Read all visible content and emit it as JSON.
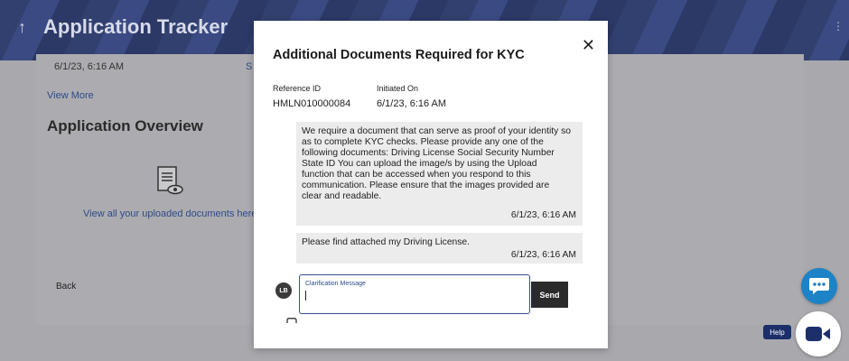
{
  "background": {
    "header_title": "Application Tracker",
    "date_text": "6/1/23, 6:16 AM",
    "status_fragment": "S",
    "view_more": "View More",
    "section_title": "Application Overview",
    "view_all_docs": "View all your uploaded documents here",
    "back_label": "Back"
  },
  "modal": {
    "title": "Additional Documents Required for KYC",
    "reference_label": "Reference ID",
    "reference_value": "HMLN010000084",
    "initiated_label": "Initiated On",
    "initiated_value": "6/1/23, 6:16 AM",
    "messages": [
      {
        "text": "We require a document that can serve as proof of your identity so as to complete KYC checks. Please provide any one of the following documents: Driving License Social Security Number State ID You can upload the image/s by using the Upload function that can be accessed when you respond to this communication. Please ensure that the images provided are clear and readable.",
        "time": "6/1/23, 6:16 AM"
      },
      {
        "text": "Please find attached my Driving License.",
        "time": "6/1/23, 6:16 AM"
      }
    ],
    "avatar_initials": "LB",
    "input_label": "Clarification Message",
    "input_value": "",
    "send_label": "Send"
  },
  "floating": {
    "help_label": "Help"
  },
  "colors": {
    "header_bg": "#2f3d73",
    "accent_blue": "#1d82c6",
    "help_bg": "#1c2f6b",
    "send_bg": "#2b2b2b",
    "bubble_bg": "#ececec"
  }
}
